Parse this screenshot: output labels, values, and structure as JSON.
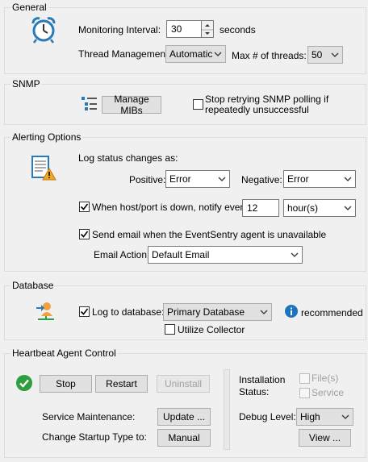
{
  "general": {
    "legend": "General",
    "monitoring_interval_label": "Monitoring Interval:",
    "monitoring_interval_value": "30",
    "seconds_label": "seconds",
    "thread_management_label": "Thread Management:",
    "thread_management_value": "Automatic",
    "max_threads_label": "Max # of threads:",
    "max_threads_value": "50"
  },
  "snmp": {
    "legend": "SNMP",
    "manage_mibs_button": "Manage MIBs",
    "stop_retrying_label": "Stop retrying SNMP polling if repeatedly unsuccessful",
    "stop_retrying_checked": false
  },
  "alerting": {
    "legend": "Alerting Options",
    "log_status_label": "Log status changes as:",
    "positive_label": "Positive:",
    "positive_value": "Error",
    "negative_label": "Negative:",
    "negative_value": "Error",
    "host_down_label": "When host/port is down, notify every",
    "host_down_checked": true,
    "notify_interval_value": "12",
    "notify_unit_value": "hour(s)",
    "send_email_label": "Send email when the EventSentry agent is unavailable",
    "send_email_checked": true,
    "email_action_label": "Email Action:",
    "email_action_value": "Default Email"
  },
  "database": {
    "legend": "Database",
    "log_to_db_label": "Log to database:",
    "log_to_db_checked": true,
    "database_value": "Primary Database",
    "recommended_label": "recommended",
    "utilize_collector_label": "Utilize Collector",
    "utilize_collector_checked": false
  },
  "heartbeat": {
    "legend": "Heartbeat Agent Control",
    "stop_button": "Stop",
    "restart_button": "Restart",
    "uninstall_button": "Uninstall",
    "service_maintenance_label": "Service Maintenance:",
    "update_button": "Update ...",
    "change_startup_label": "Change Startup Type to:",
    "manual_button": "Manual",
    "installation_status_label": "Installation Status:",
    "files_label": "File(s)",
    "service_label": "Service",
    "debug_level_label": "Debug Level:",
    "debug_level_value": "High",
    "view_button": "View ..."
  },
  "colors": {
    "status_ok": "#2e9e3e",
    "info": "#1e73be",
    "alarm_clock": "#2a7ab8"
  }
}
